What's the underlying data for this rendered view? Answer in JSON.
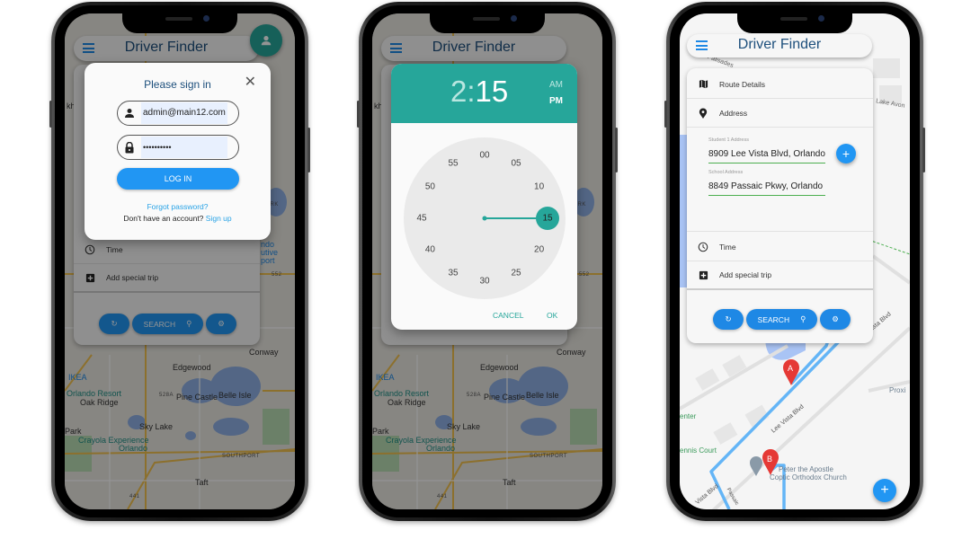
{
  "app": {
    "title": "Driver Finder"
  },
  "colors": {
    "primary": "#2196f3",
    "teal": "#26a69a",
    "title": "#1d4f7c",
    "underline": "#4caf50",
    "marker": "#e53935",
    "route": "#64b5f6"
  },
  "map_overview": {
    "labels": [
      "kh",
      "IKEA",
      "Orlando Resort",
      "Oak Ridge",
      "Park",
      "Edgewood",
      "528A",
      "Pine Castle",
      "Belle Isle",
      "Sky Lake",
      "Crayola Experience",
      "Orlando",
      "SOUTHPORT",
      "Taft",
      "Conway",
      "441",
      "552",
      "PARK",
      "ndo",
      "utive",
      "port"
    ]
  },
  "panel": {
    "route_details": "Route Details",
    "address": "Address",
    "time": "Time",
    "add_special_trip": "Add special trip",
    "search": "SEARCH"
  },
  "signin": {
    "title": "Please sign in",
    "email": "admin@main12.com",
    "password": "••••••••••",
    "login": "LOG IN",
    "forgot": "Forgot password?",
    "no_account": "Don't have an account?",
    "signup": "Sign up"
  },
  "timepicker": {
    "hour": "2",
    "separator": ":",
    "minute": "15",
    "am": "AM",
    "pm": "PM",
    "selected_period": "PM",
    "numbers": [
      "00",
      "05",
      "10",
      "15",
      "20",
      "25",
      "30",
      "35",
      "40",
      "45",
      "50",
      "55"
    ],
    "selected_minute": 15,
    "cancel": "CANCEL",
    "ok": "OK"
  },
  "address_form": {
    "student_label": "Student 1 Address",
    "student_value": "8909 Lee Vista Blvd, Orlando",
    "school_label": "School Address",
    "school_value": "8849 Passaic Pkwy, Orlando"
  },
  "map_detail": {
    "labels": [
      "Palisades",
      "Lake Avon",
      "Lee Vista Blvd",
      "Lee Vista Blvd",
      "Proxi",
      "enter",
      "ennis Court",
      "Peter the Apostle",
      "Coptic Orthodox Church",
      "Vista Blvd",
      "Passaic"
    ],
    "marker_a": "A",
    "marker_b": "B"
  }
}
